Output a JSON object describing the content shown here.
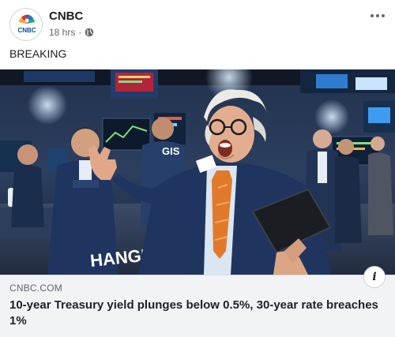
{
  "post": {
    "author": "CNBC",
    "timestamp": "18 hrs",
    "separator": "·",
    "privacy_icon": "globe-icon",
    "text": "BREAKING",
    "more_icon": "more-options-icon"
  },
  "link": {
    "domain": "CNBC.COM",
    "headline": "10-year Treasury yield plunges below 0.5%, 30-year rate breaches 1%",
    "info_icon": "i"
  },
  "photo": {
    "sign_gis": "GIS",
    "sign_change": "HANGE"
  },
  "colors": {
    "author": "#1c1e21",
    "meta": "#65676b",
    "link_bg": "#f2f3f5",
    "tie": "#e07a2a",
    "suit": "#1f3560"
  }
}
